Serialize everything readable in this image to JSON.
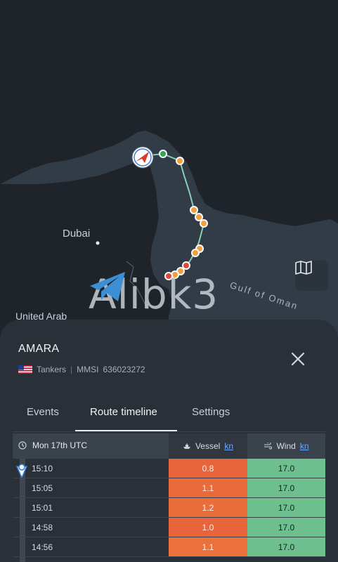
{
  "map": {
    "labels": {
      "dubai": "Dubai",
      "uae": "United Arab",
      "gulf": "Gulf of Oman"
    },
    "watermark": "Alibk3",
    "colors": {
      "water": "#323c47",
      "land": "#1f242b",
      "track": "#8ccfb5",
      "orange": "#f0a040",
      "red": "#d94b3b"
    },
    "map_button_icon": "map-icon",
    "vessel_icon": "vessel-position-icon"
  },
  "vessel": {
    "name": "AMARA",
    "type": "Tankers",
    "mmsi_label": "MMSI",
    "mmsi": "636023272",
    "separator": "|"
  },
  "tabs": [
    {
      "label": "Events"
    },
    {
      "label": "Route timeline"
    },
    {
      "label": "Settings"
    }
  ],
  "table": {
    "date_header": "Mon 17th UTC",
    "vessel_header": "Vessel",
    "wind_header": "Wind",
    "unit": "kn",
    "rows": [
      {
        "time": "15:10",
        "vessel": "0.8",
        "wind": "17.0",
        "vessel_color": "#e8643a"
      },
      {
        "time": "15:05",
        "vessel": "1.1",
        "wind": "17.0",
        "vessel_color": "#e96a3b"
      },
      {
        "time": "15:01",
        "vessel": "1.2",
        "wind": "17.0",
        "vessel_color": "#ea6e3c"
      },
      {
        "time": "14:58",
        "vessel": "1.0",
        "wind": "17.0",
        "vessel_color": "#e8643a"
      },
      {
        "time": "14:56",
        "vessel": "1.1",
        "wind": "17.0",
        "vessel_color": "#ea703c"
      }
    ]
  }
}
